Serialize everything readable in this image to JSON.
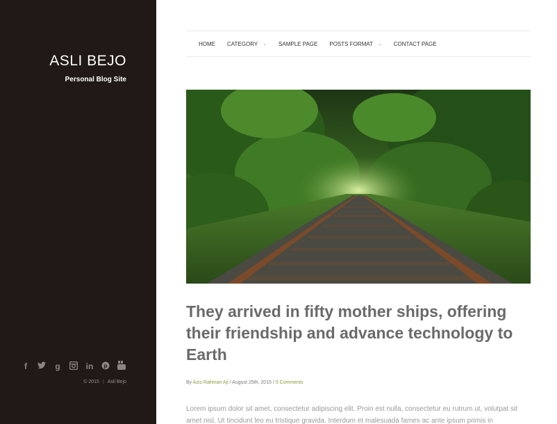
{
  "site": {
    "title": "ASLI BEJO",
    "tagline": "Personal Blog Site"
  },
  "social": {
    "icons": [
      "facebook-icon",
      "twitter-icon",
      "googleplus-icon",
      "instagram-icon",
      "linkedin-icon",
      "pinterest-icon",
      "youtube-icon"
    ],
    "glyphs": [
      "f",
      "t",
      "g",
      "◙",
      "in",
      "℗",
      "▣"
    ]
  },
  "footer": {
    "year": "© 2015",
    "author": "Asli Bejo"
  },
  "nav": {
    "items": [
      {
        "label": "HOME",
        "has_caret": false
      },
      {
        "label": "CATEGORY",
        "has_caret": true
      },
      {
        "label": "SAMPLE PAGE",
        "has_caret": false
      },
      {
        "label": "POSTS FORMAT",
        "has_caret": true
      },
      {
        "label": "CONTACT PAGE",
        "has_caret": false
      }
    ]
  },
  "post": {
    "title": "They arrived in fifty mother ships, offering their friendship and advance technology to Earth",
    "meta_by": "By",
    "author": "Aziz Rahman Aji",
    "date": " / August 25th, 2015 / ",
    "comments": "0 Comments",
    "excerpt": "Lorem ipsum dolor sit amet, consectetur adipiscing elit. Proin est nulla, consectetur eu rutrum ut, volutpat sit amet nisl. Ut tincidunt leo eu tristique gravida. Interdum et malesuada fames ac ante ipsum primis in"
  },
  "colors": {
    "sidebar_bg": "#211916",
    "accent": "#8a9a3a",
    "title": "#6a6a6a"
  }
}
